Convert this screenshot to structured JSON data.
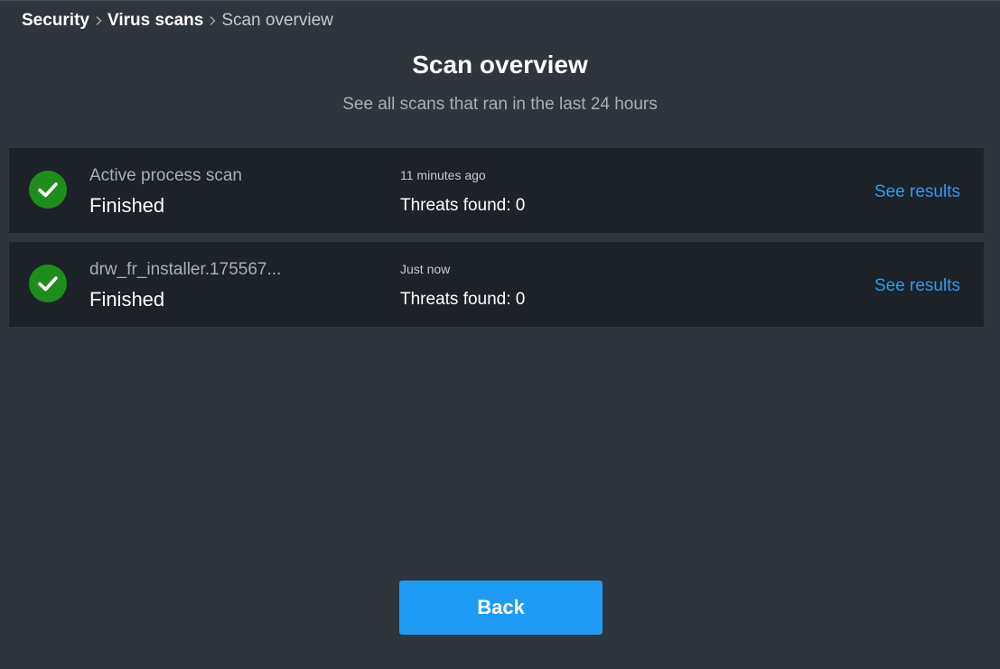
{
  "breadcrumb": {
    "items": [
      {
        "label": "Security"
      },
      {
        "label": "Virus scans"
      },
      {
        "label": "Scan overview"
      }
    ],
    "separator_icon": "chevron-right-icon"
  },
  "header": {
    "title": "Scan overview",
    "subtitle": "See all scans that ran in the last 24 hours"
  },
  "scans": [
    {
      "name": "Active process scan",
      "status": "Finished",
      "time": "11 minutes ago",
      "threats": "Threats found: 0",
      "action_label": "See results",
      "icon": "checkmark-icon"
    },
    {
      "name": "drw_fr_installer.175567...",
      "status": "Finished",
      "time": "Just now",
      "threats": "Threats found: 0",
      "action_label": "See results",
      "icon": "checkmark-icon"
    }
  ],
  "footer": {
    "back_label": "Back"
  },
  "colors": {
    "background": "#2f353d",
    "card": "#1d2228",
    "success": "#1e8d1e",
    "accent": "#1e9cf5",
    "link": "#2f9bea"
  }
}
